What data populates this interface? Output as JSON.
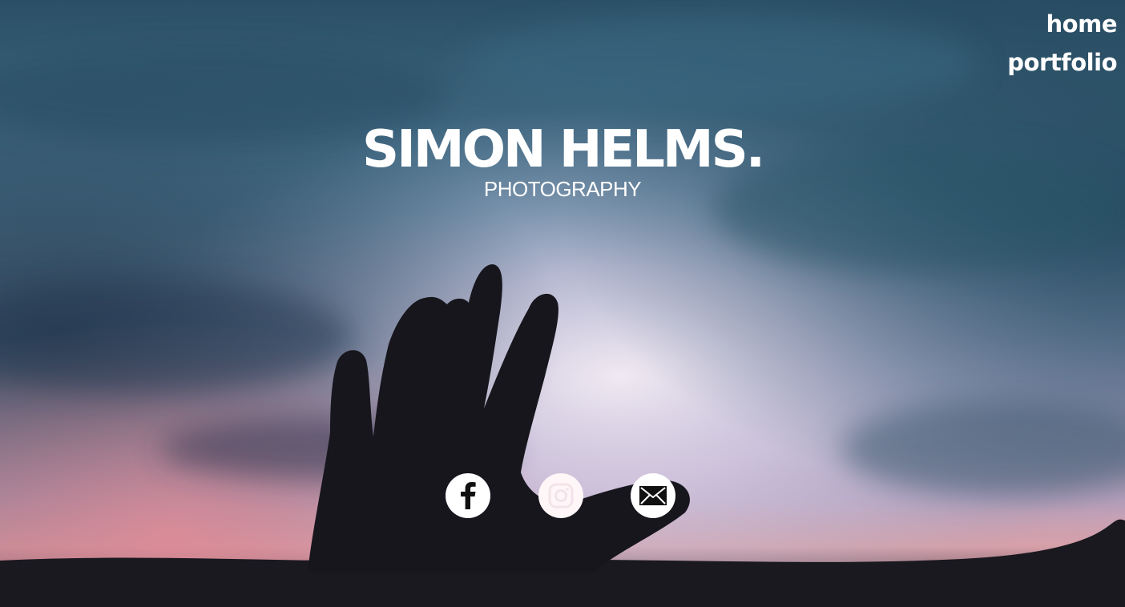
{
  "nav": {
    "items": [
      {
        "label": "home"
      },
      {
        "label": "portfolio"
      }
    ]
  },
  "hero": {
    "title": "SIMON HELMS.",
    "subtitle": "PHOTOGRAPHY"
  },
  "social": [
    {
      "name": "facebook",
      "icon": "facebook-icon"
    },
    {
      "name": "instagram",
      "icon": "instagram-icon"
    },
    {
      "name": "email",
      "icon": "mail-icon"
    }
  ],
  "colors": {
    "text": "#ffffff",
    "sky_top": "#2f5a72",
    "sky_glow": "#e9e2f0",
    "horizon_pink": "#d98fa0",
    "silhouette": "#15151c"
  }
}
